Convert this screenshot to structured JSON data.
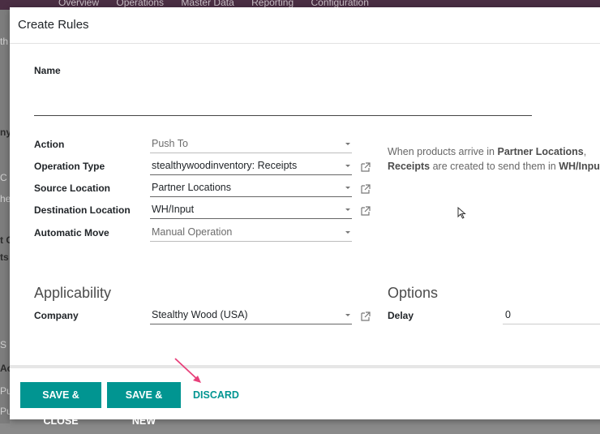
{
  "background": {
    "menu": [
      "Overview",
      "Operations",
      "Master Data",
      "Reporting",
      "Configuration"
    ],
    "fragments": [
      "th",
      "ny",
      "C",
      "he",
      "t C",
      "ts",
      "S",
      "Ac",
      "Pu",
      "Pu"
    ]
  },
  "modal": {
    "title": "Create Rules",
    "name_label": "Name",
    "name_value": "",
    "fields": {
      "action": {
        "label": "Action",
        "value": "Push To"
      },
      "operation_type": {
        "label": "Operation Type",
        "value": "stealthywoodinventory: Receipts"
      },
      "source_location": {
        "label": "Source Location",
        "value": "Partner Locations"
      },
      "destination_location": {
        "label": "Destination Location",
        "value": "WH/Input"
      },
      "automatic_move": {
        "label": "Automatic Move",
        "value": "Manual Operation"
      }
    },
    "help": {
      "part1": "When products arrive in ",
      "bold1": "Partner Locations",
      "part2": ",",
      "bold2": "Receipts",
      "part3": " are created to send them in ",
      "bold3": "WH/Input",
      "part4": "."
    },
    "applicability": {
      "heading": "Applicability",
      "company_label": "Company",
      "company_value": "Stealthy Wood (USA)"
    },
    "options": {
      "heading": "Options",
      "delay_label": "Delay",
      "delay_value": "0"
    },
    "footer": {
      "save_close": "SAVE & CLOSE",
      "save_new": "SAVE & NEW",
      "discard": "DISCARD"
    }
  },
  "colors": {
    "primary": "#019591",
    "arrow": "#e8407a"
  },
  "icons": [
    "external-link-icon",
    "dropdown-caret-icon",
    "mouse-cursor-icon",
    "pointer-arrow-icon"
  ]
}
